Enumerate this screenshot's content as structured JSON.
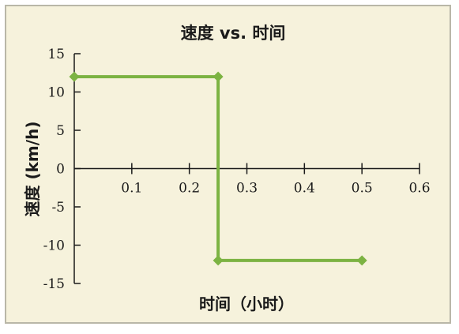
{
  "chart_data": {
    "type": "line",
    "title": "速度 vs. 时间",
    "xlabel": "时间（小时）",
    "ylabel": "速度 (km/h)",
    "xlim": [
      0,
      0.6
    ],
    "ylim": [
      -15,
      15
    ],
    "x_ticks": [
      0.1,
      0.2,
      0.3,
      0.4,
      0.5,
      0.6
    ],
    "x_tick_labels": [
      "0.1",
      "0.2",
      "0.3",
      "0.4",
      "0.5",
      "0.6"
    ],
    "y_ticks": [
      15,
      10,
      5,
      0,
      -5,
      -10,
      -15
    ],
    "y_tick_labels": [
      "15",
      "10",
      "5",
      "0",
      "-5",
      "-10",
      "-15"
    ],
    "grid": false,
    "series": [
      {
        "x": [
          0,
          0.25,
          0.25,
          0.5
        ],
        "y": [
          12,
          12,
          -12,
          -12
        ],
        "color": "#7cb342"
      }
    ]
  }
}
